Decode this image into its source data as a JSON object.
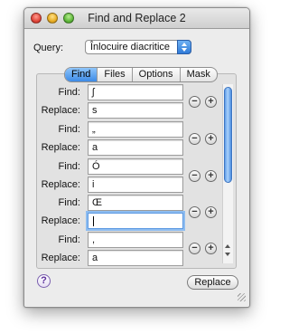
{
  "window": {
    "title": "Find and Replace 2"
  },
  "query": {
    "label": "Query:",
    "value": "Înlocuire diacritice"
  },
  "tabs": [
    {
      "label": "Find",
      "selected": true
    },
    {
      "label": "Files",
      "selected": false
    },
    {
      "label": "Options",
      "selected": false
    },
    {
      "label": "Mask",
      "selected": false
    }
  ],
  "labels": {
    "find": "Find:",
    "replace": "Replace:"
  },
  "pairs": [
    {
      "find": "ʃ",
      "replace": "s"
    },
    {
      "find": "„",
      "replace": "a"
    },
    {
      "find": "Ó",
      "replace": "i"
    },
    {
      "find": "Œ",
      "replace": ""
    },
    {
      "find": ",",
      "replace": "a"
    }
  ],
  "buttons": {
    "remove": "−",
    "add": "+",
    "help": "?",
    "replace": "Replace"
  },
  "colors": {
    "accent": "#3d8ae6",
    "window_bg": "#ececec"
  }
}
